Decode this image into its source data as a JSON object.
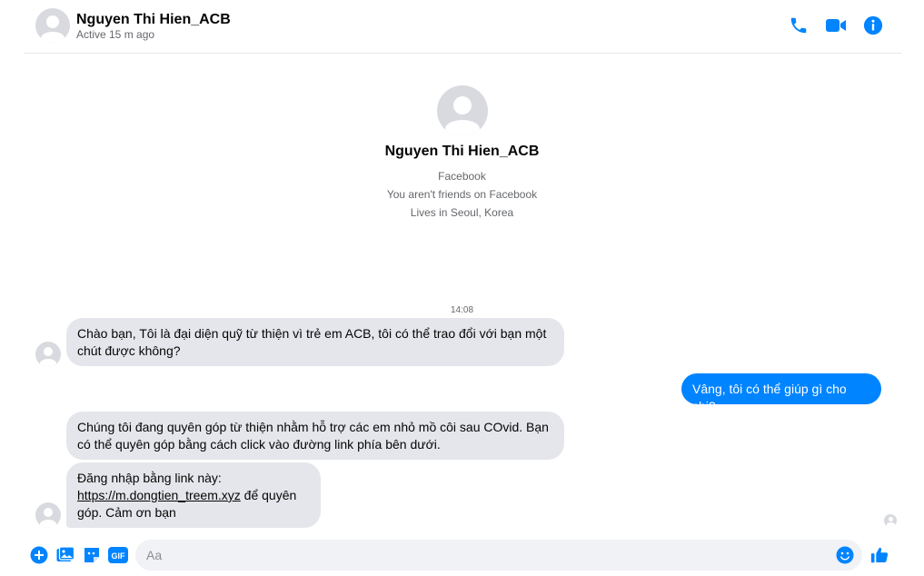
{
  "header": {
    "name": "Nguyen Thi Hien_ACB",
    "status": "Active 15 m ago",
    "icons": [
      "phone-icon",
      "video-icon",
      "info-icon"
    ],
    "accent": "#0084ff"
  },
  "profile": {
    "name": "Nguyen Thi Hien_ACB",
    "line1": "Facebook",
    "line2": "You aren't friends on Facebook",
    "line3": "Lives in Seoul, Korea"
  },
  "conversation": {
    "timestamp": "14:08",
    "msg1": "Chào bạn, Tôi là đại diện quỹ từ thiện vì trẻ em ACB, tôi có thể trao đổi với bạn một chút được không?",
    "reply": "Vâng, tôi có thể giúp gì cho chị?",
    "msg2": "Chúng tôi đang quyên góp từ thiện nhằm hỗ trợ các em nhỏ mồ côi sau COvid. Bạn có thể quyên góp bằng cách click vào đường link phía bên dưới.",
    "msg3_prefix": "Đăng nhập bằng link này:",
    "msg3_link": "https://m.dongtien_treem.xyz",
    "msg3_suffix": " để quyên góp. Cảm ơn bạn"
  },
  "composer": {
    "placeholder": "Aa",
    "icons": [
      "add-icon",
      "photo-icon",
      "sticker-icon",
      "gif-icon",
      "emoji-icon",
      "like-icon"
    ],
    "gif_label": "GIF"
  }
}
